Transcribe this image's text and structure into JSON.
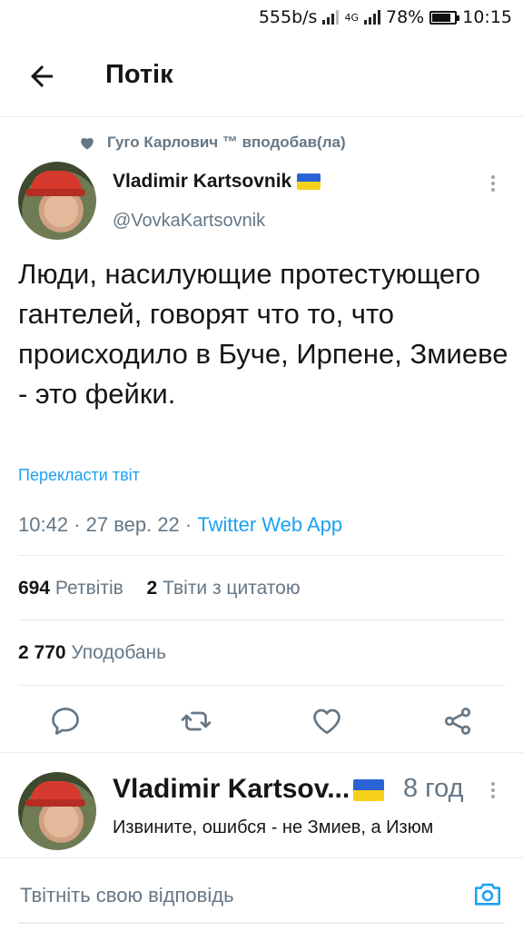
{
  "status_bar": {
    "speed": "555b/s",
    "network": "4G",
    "battery": "78%",
    "time": "10:15"
  },
  "header": {
    "title": "Потік"
  },
  "tweet": {
    "liked_by": "Гуго Карлович ™ вподобав(ла)",
    "author_name": "Vladimir Kartsovnik",
    "author_handle": "@VovkaKartsovnik",
    "text": "Люди, насилующие протестующего гантелей, говорят что то, что происходило в Буче, Ирпене, Змиеве - это фейки.",
    "translate": "Перекласти твіт",
    "time": "10:42 · 27 вер. 22 · ",
    "source": "Twitter Web App",
    "retweets_count": "694",
    "retweets_label": "Ретвітів",
    "quotes_count": "2",
    "quotes_label": "Твіти з цитатою",
    "likes_count": "2 770",
    "likes_label": "Уподобань"
  },
  "reply": {
    "author_name": "Vladimir Kartsov...",
    "time": "8 год",
    "text": "Извините, ошибся - не Змиев, а Изюм"
  },
  "composer": {
    "placeholder": "Твітніть свою відповідь"
  },
  "colors": {
    "accent": "#1da1f2",
    "muted": "#657786",
    "text": "#14171a",
    "flag_blue": "#2a63d6",
    "flag_yellow": "#f6d11a"
  },
  "icons": [
    "back-arrow-icon",
    "heart-icon",
    "more-vertical-icon",
    "reply-icon",
    "retweet-icon",
    "like-icon",
    "share-icon",
    "camera-icon"
  ]
}
